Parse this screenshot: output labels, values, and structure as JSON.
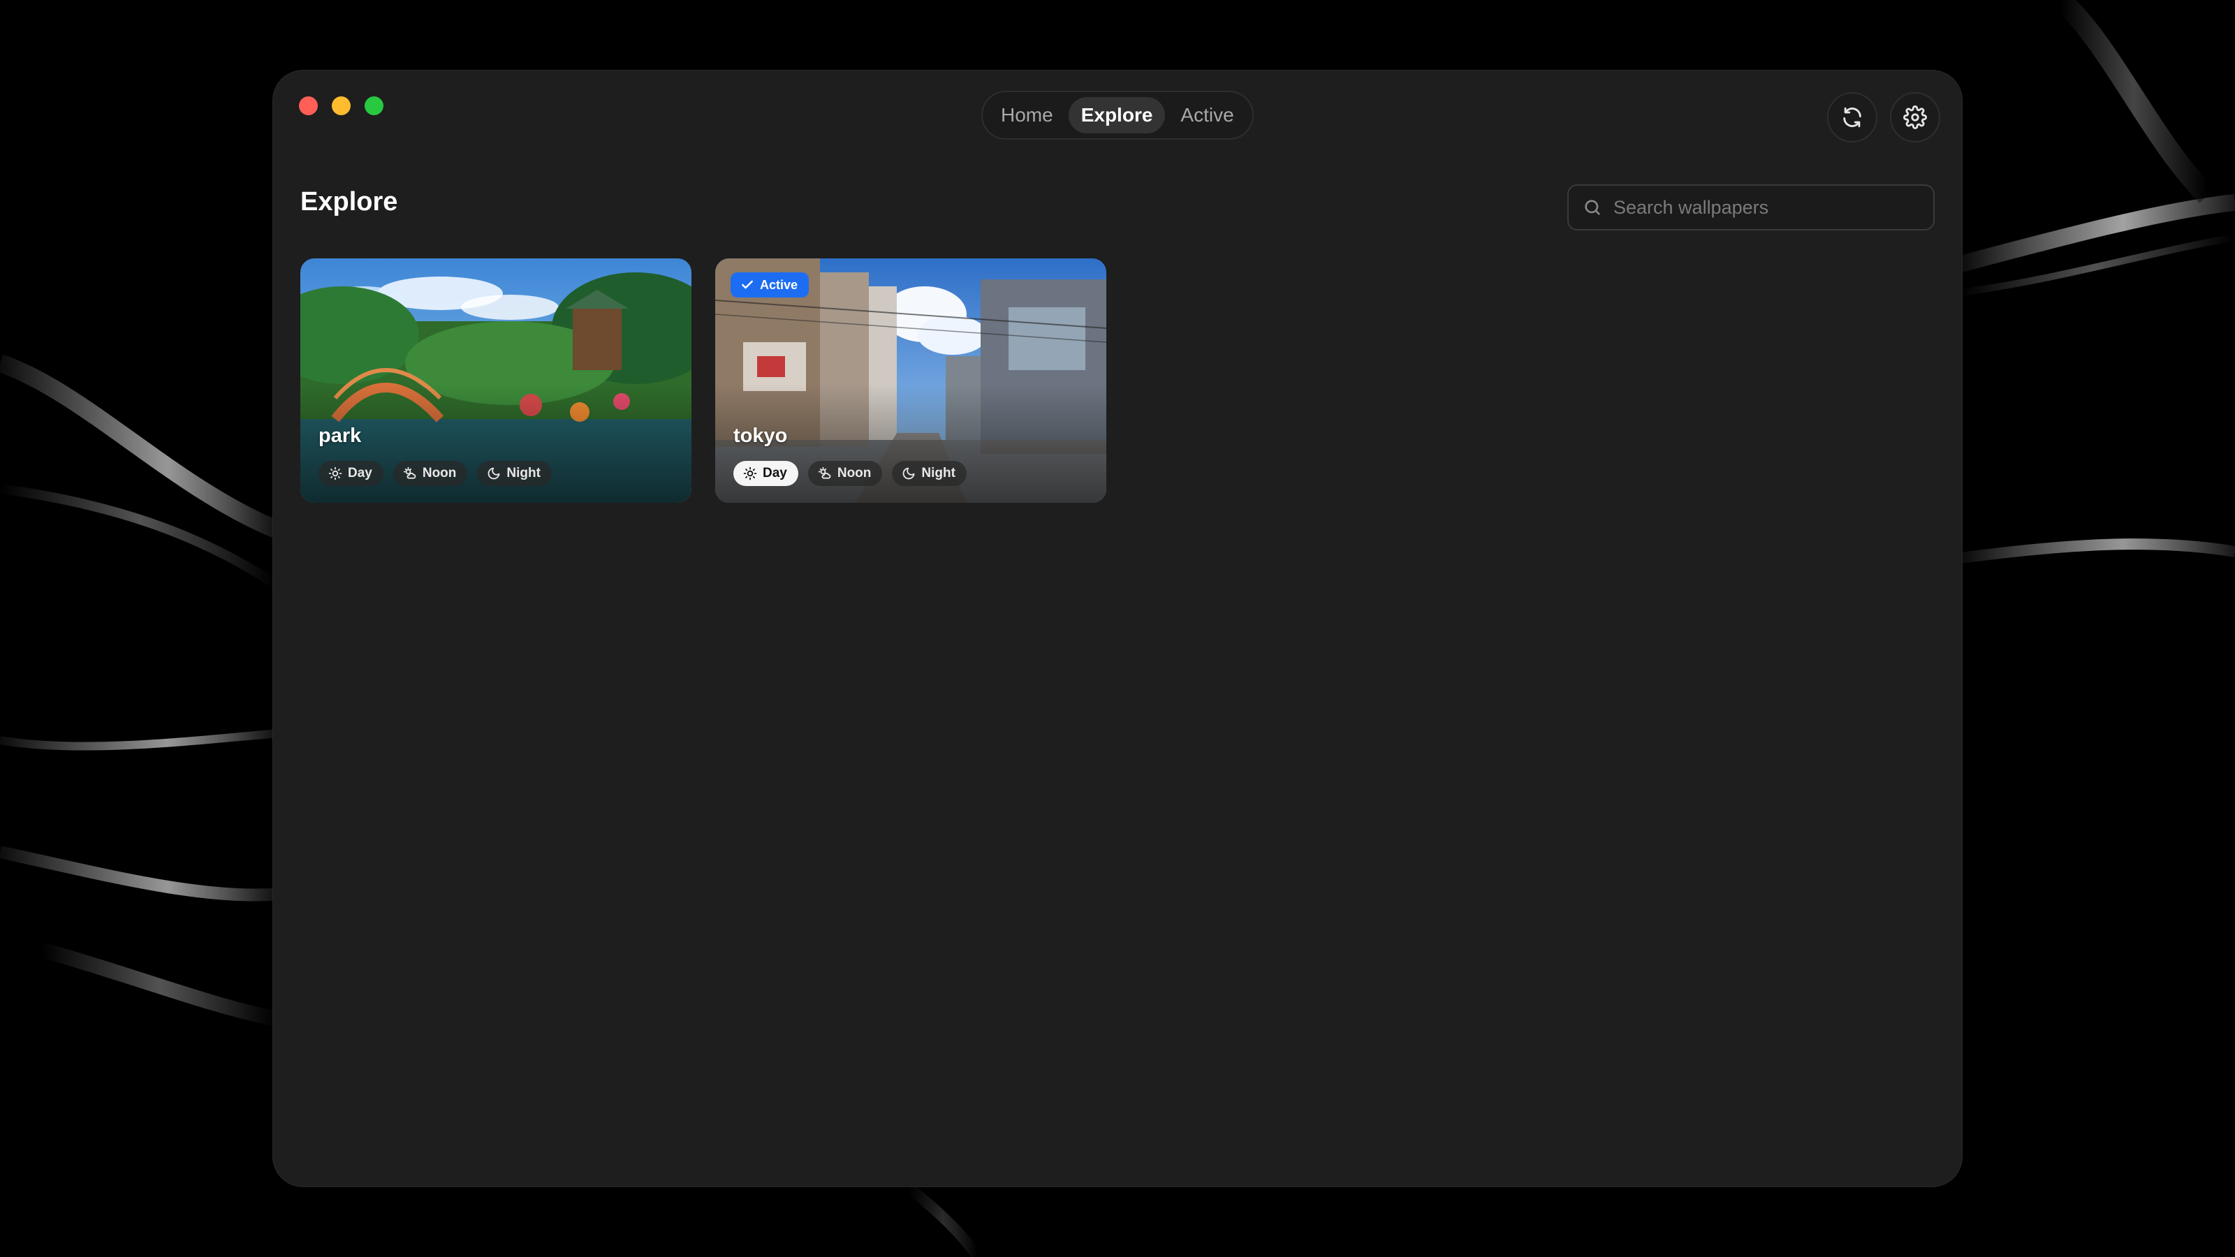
{
  "nav": {
    "tabs": [
      {
        "label": "Home",
        "active": false
      },
      {
        "label": "Explore",
        "active": true
      },
      {
        "label": "Active",
        "active": false
      }
    ]
  },
  "toolbar": {
    "refresh_icon": "refresh-icon",
    "settings_icon": "gear-icon"
  },
  "page": {
    "title": "Explore"
  },
  "search": {
    "placeholder": "Search wallpapers",
    "value": ""
  },
  "wallpapers": [
    {
      "name": "park",
      "active": false,
      "modes": [
        {
          "label": "Day",
          "icon": "sun-icon",
          "selected": false
        },
        {
          "label": "Noon",
          "icon": "sun-cloud-icon",
          "selected": false
        },
        {
          "label": "Night",
          "icon": "moon-icon",
          "selected": false
        }
      ]
    },
    {
      "name": "tokyo",
      "active": true,
      "badge": "Active",
      "modes": [
        {
          "label": "Day",
          "icon": "sun-icon",
          "selected": true
        },
        {
          "label": "Noon",
          "icon": "sun-cloud-icon",
          "selected": false
        },
        {
          "label": "Night",
          "icon": "moon-icon",
          "selected": false
        }
      ]
    }
  ],
  "colors": {
    "window_bg": "#1e1e1e",
    "accent": "#1d6df2",
    "traffic_red": "#ff5f57",
    "traffic_yellow": "#febc2e",
    "traffic_green": "#28c840"
  }
}
